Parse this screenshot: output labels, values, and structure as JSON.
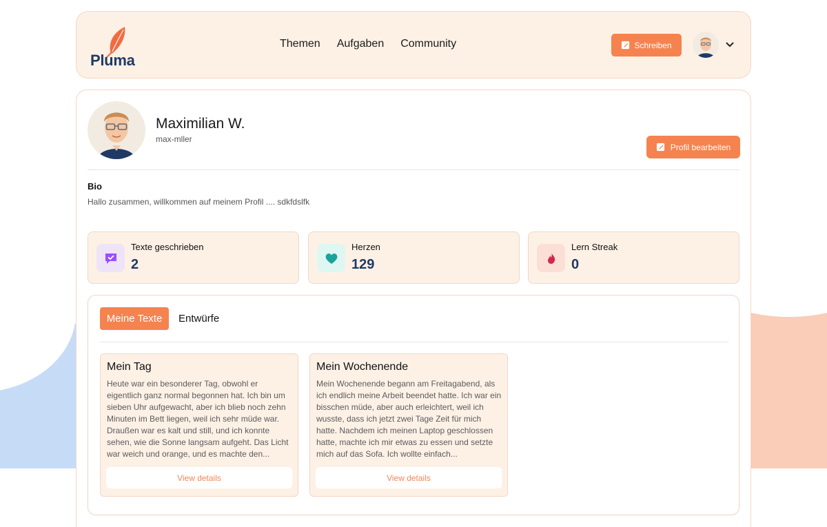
{
  "brand": {
    "name": "Pluma"
  },
  "nav": {
    "items": [
      "Themen",
      "Aufgaben",
      "Community"
    ]
  },
  "header": {
    "write_label": "Schreiben"
  },
  "profile": {
    "name": "Maximilian W.",
    "username": "max-mller",
    "edit_label": "Profil bearbeiten",
    "bio_title": "Bio",
    "bio_text": "Hallo zusammen, willkommen auf meinem Profil .... sdkfdslfk"
  },
  "stats": [
    {
      "label": "Texte geschrieben",
      "value": "2",
      "icon": "check-message-icon",
      "color": "#9b4dff",
      "bg": "#efe3f8"
    },
    {
      "label": "Herzen",
      "value": "129",
      "icon": "heart-icon",
      "color": "#1aa39a",
      "bg": "#dff7f2"
    },
    {
      "label": "Lern Streak",
      "value": "0",
      "icon": "flame-icon",
      "color": "#d4264f",
      "bg": "#fbdfd6"
    }
  ],
  "tabs": {
    "active": "Meine Texte",
    "other": "Entwürfe"
  },
  "texts": [
    {
      "title": "Mein Tag",
      "excerpt": "Heute war ein besonderer Tag, obwohl er eigentlich ganz normal begonnen hat. Ich bin um sieben Uhr aufgewacht, aber ich blieb noch zehn Minuten im Bett liegen, weil ich sehr müde war. Draußen war es kalt und still, und ich konnte sehen, wie die Sonne langsam aufgeht. Das Licht war weich und orange, und es machte den...",
      "action": "View details"
    },
    {
      "title": "Mein Wochenende",
      "excerpt": "Mein Wochenende begann am Freitagabend, als ich endlich meine Arbeit beendet hatte. Ich war ein bisschen müde, aber auch erleichtert, weil ich wusste, dass ich jetzt zwei Tage Zeit für mich hatte. Nachdem ich meinen Laptop geschlossen hatte, machte ich mir etwas zu essen und setzte mich auf das Sofa. Ich wollte einfach...",
      "action": "View details"
    }
  ],
  "colors": {
    "accent": "#f5834f",
    "navy": "#1f3a64",
    "card_bg": "#fdf1e6"
  }
}
